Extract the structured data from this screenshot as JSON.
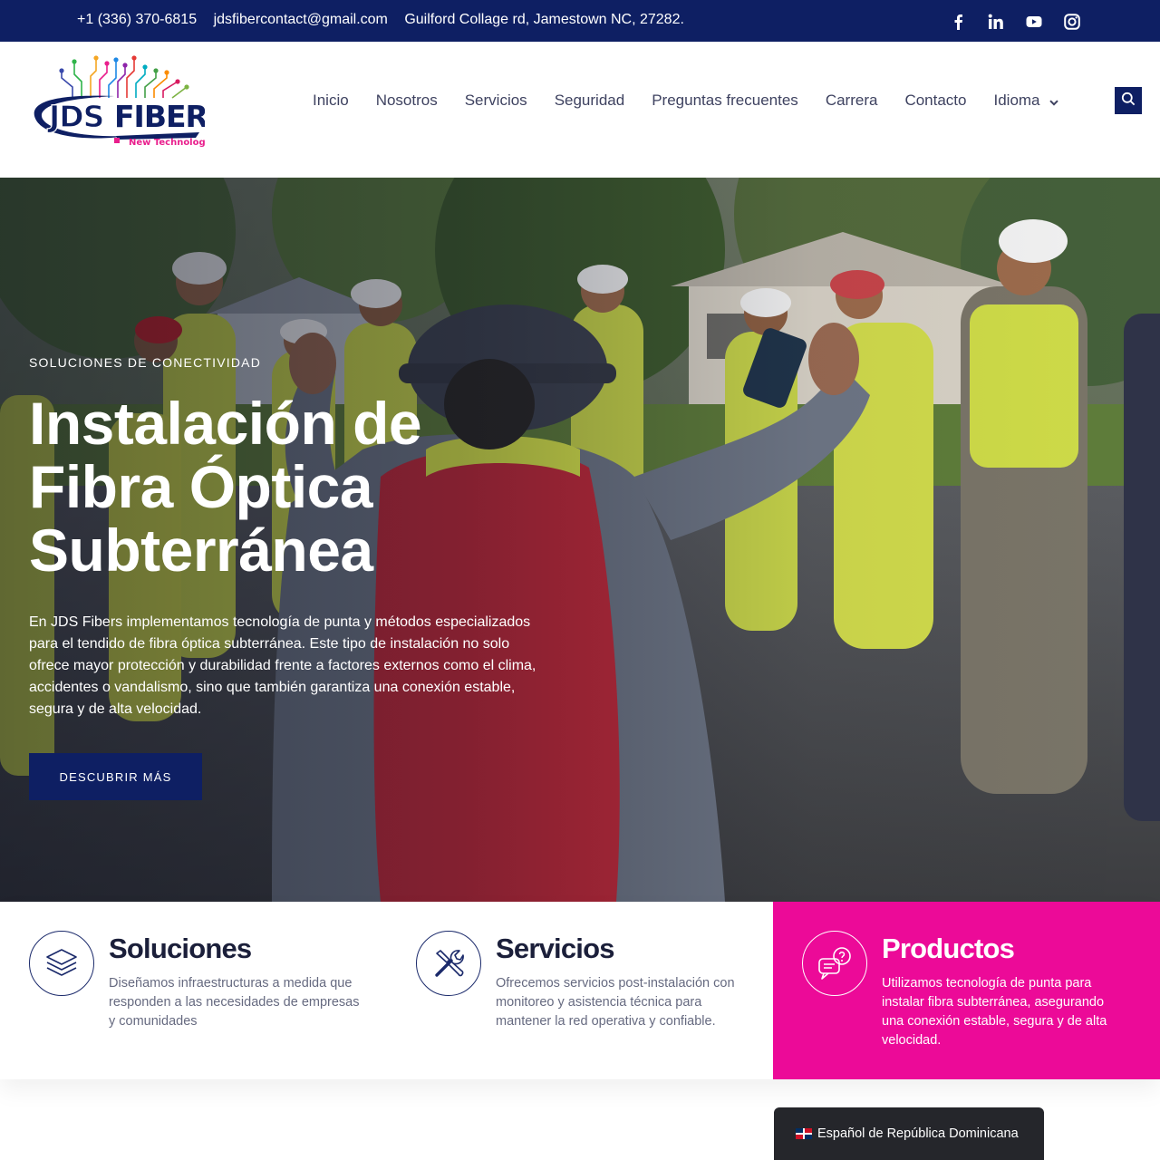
{
  "topbar": {
    "phone": "+1 (336) 370-6815",
    "email": "jdsfibercontact@gmail.com",
    "address": "Guilford Collage rd, Jamestown NC, 27282.",
    "social_icons": [
      "facebook-icon",
      "linkedin-icon",
      "youtube-icon",
      "instagram-icon"
    ]
  },
  "logo": {
    "text": "JDSFIBER",
    "tagline": "New Technology"
  },
  "nav": {
    "items": [
      "Inicio",
      "Nosotros",
      "Servicios",
      "Seguridad",
      "Preguntas frecuentes",
      "Carrera",
      "Contacto",
      "Idioma"
    ]
  },
  "hero": {
    "eyebrow": "SOLUCIONES DE CONECTIVIDAD",
    "title_line1": "Instalación de",
    "title_line2": "Fibra Óptica",
    "title_line3": "Subterránea",
    "paragraph": "En JDS Fibers implementamos tecnología de punta y métodos especializados para el tendido de fibra óptica subterránea. Este tipo de instalación no solo ofrece mayor protección y durabilidad frente a factores externos como el clima, accidentes o vandalismo, sino que también garantiza una conexión estable, segura y de alta velocidad.",
    "cta_label": "DESCUBRIR MÁS"
  },
  "features": [
    {
      "icon": "layers-icon",
      "title": "Soluciones",
      "description": "Diseñamos infraestructuras a medida que responden a las necesidades de empresas y comunidades"
    },
    {
      "icon": "tools-icon",
      "title": "Servicios",
      "description": "Ofrecemos servicios post-instalación con monitoreo y asistencia técnica para mantener la red operativa y confiable."
    },
    {
      "icon": "chat-question-icon",
      "title": "Productos",
      "description": "Utilizamos tecnología de punta para instalar fibra subterránea, asegurando una conexión estable, segura y de alta velocidad."
    }
  ],
  "language_switcher": {
    "label": "Español de República Dominicana",
    "flag_icon": "dominican-flag-icon"
  },
  "colors": {
    "brand_navy": "#0e1f63",
    "accent_magenta": "#ec0a98"
  }
}
